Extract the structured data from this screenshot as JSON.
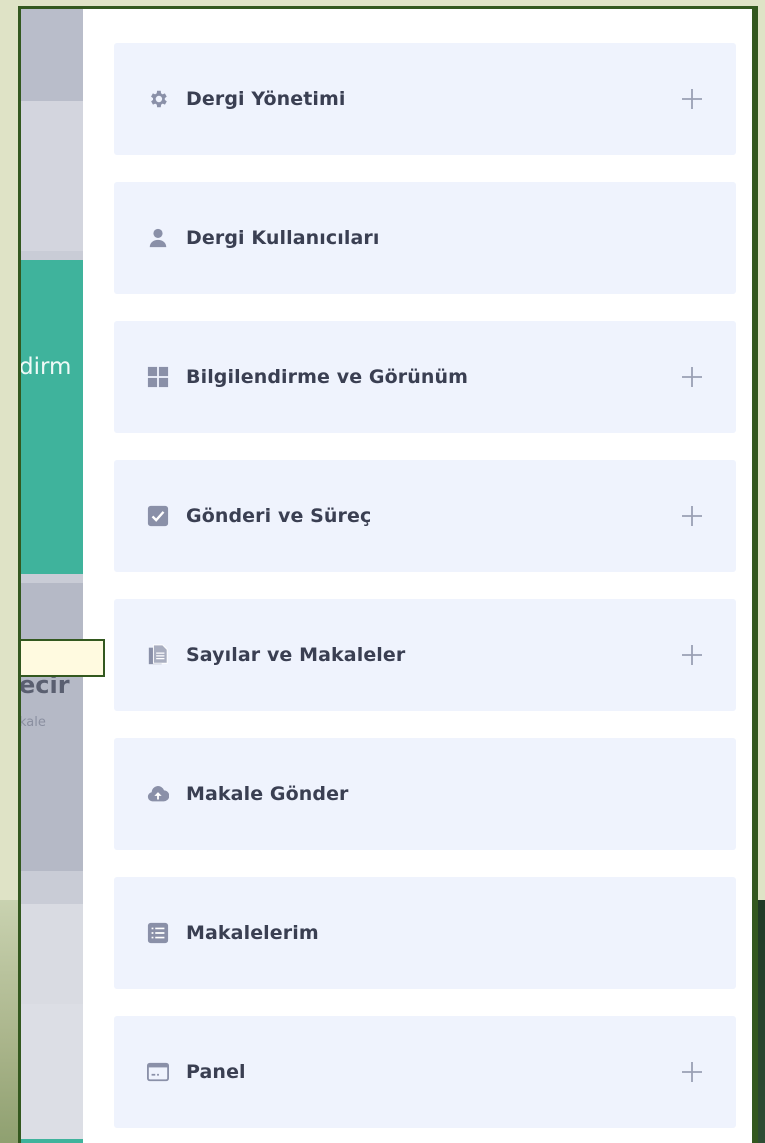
{
  "background_page": {
    "teal_banner_text": "dirm",
    "card_title": "ecir",
    "card_subtitle": "kale"
  },
  "menu": {
    "items": [
      {
        "label": "Dergi Yönetimi",
        "icon": "gear-icon",
        "expandable": true
      },
      {
        "label": "Dergi Kullanıcıları",
        "icon": "user-icon",
        "expandable": false
      },
      {
        "label": "Bilgilendirme ve Görünüm",
        "icon": "grid-icon",
        "expandable": true
      },
      {
        "label": "Gönderi ve Süreç",
        "icon": "checkbox-icon",
        "expandable": true
      },
      {
        "label": "Sayılar ve Makaleler",
        "icon": "documents-icon",
        "expandable": true
      },
      {
        "label": "Makale Gönder",
        "icon": "cloud-upload-icon",
        "expandable": false
      },
      {
        "label": "Makalelerim",
        "icon": "list-icon",
        "expandable": false
      },
      {
        "label": "Panel",
        "icon": "panel-icon",
        "expandable": true
      }
    ]
  },
  "colors": {
    "item_bg": "#eff3fd",
    "icon_color": "#8a90a8",
    "text_color": "#3a3f52",
    "frame_border": "#33581f",
    "teal_accent": "#3fb39c"
  }
}
